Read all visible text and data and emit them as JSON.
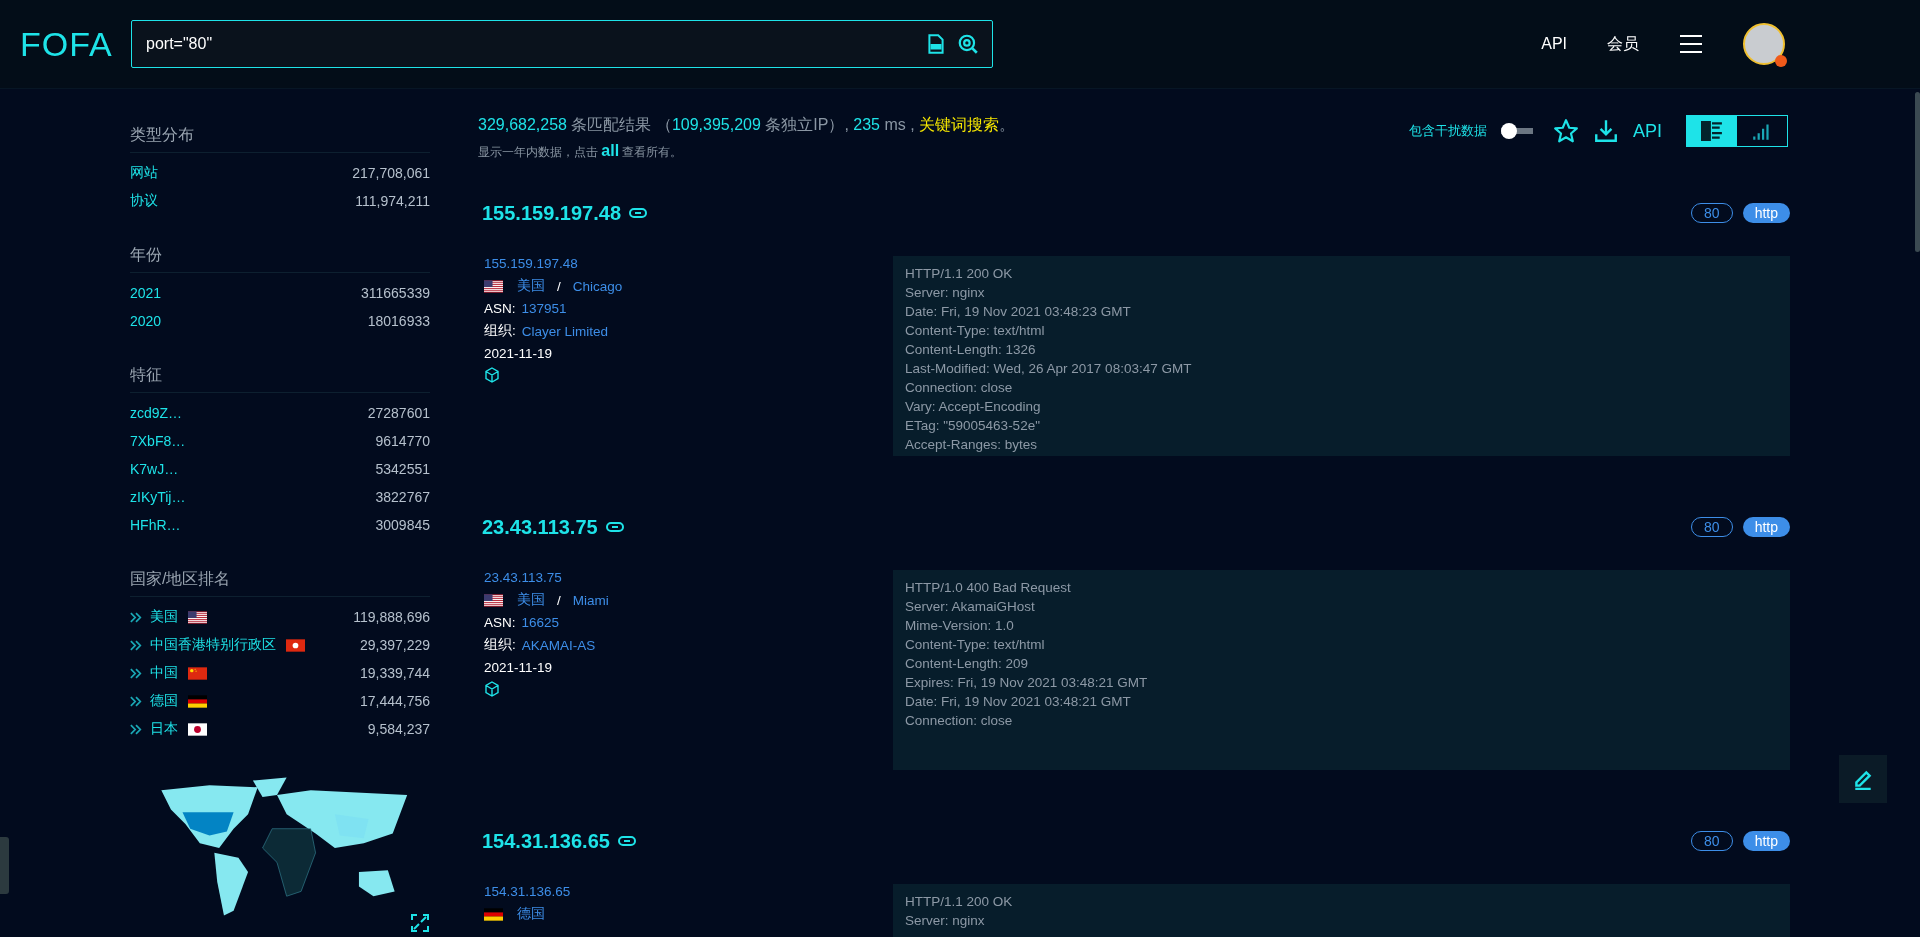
{
  "header": {
    "logo": "FOFA",
    "query": "port=\"80\"",
    "nav": [
      "API",
      "会员"
    ]
  },
  "sidebar": {
    "sections": [
      {
        "title": "类型分布",
        "kind": "plain",
        "rows": [
          {
            "label": "网站",
            "count": "217,708,061"
          },
          {
            "label": "协议",
            "count": "111,974,211"
          }
        ]
      },
      {
        "title": "年份",
        "kind": "plain",
        "rows": [
          {
            "label": "2021",
            "count": "311665339"
          },
          {
            "label": "2020",
            "count": "18016933"
          }
        ]
      },
      {
        "title": "特征",
        "kind": "plain",
        "rows": [
          {
            "label": "zcd9Z…",
            "count": "27287601"
          },
          {
            "label": "7XbF8…",
            "count": "9614770"
          },
          {
            "label": "K7wJ…",
            "count": "5342551"
          },
          {
            "label": "zIKyTij…",
            "count": "3822767"
          },
          {
            "label": "HFhR…",
            "count": "3009845"
          }
        ]
      },
      {
        "title": "国家/地区排名",
        "kind": "country",
        "rows": [
          {
            "label": "美国",
            "kind": "us",
            "count": "119,888,696"
          },
          {
            "label": "中国香港特别行政区",
            "kind": "hk",
            "count": "29,397,229"
          },
          {
            "label": "中国",
            "kind": "cn",
            "count": "19,339,744"
          },
          {
            "label": "德国",
            "kind": "de",
            "count": "17,444,756"
          },
          {
            "label": "日本",
            "kind": "jp",
            "count": "9,584,237"
          }
        ]
      }
    ]
  },
  "summary": {
    "line1": [
      {
        "kind": "number",
        "text": "329,682,258"
      },
      {
        "kind": "text",
        "text": " 条匹配结果 （"
      },
      {
        "kind": "number",
        "text": "109,395,209"
      },
      {
        "kind": "text",
        "text": " 条独立IP）,"
      },
      {
        "kind": "number",
        "text": " 235"
      },
      {
        "kind": "text",
        "text": " ms ,"
      },
      {
        "kind": "highlight",
        "text": " 关键词搜索"
      },
      {
        "kind": "text",
        "text": "。"
      }
    ],
    "line2": [
      {
        "kind": "text",
        "text": "显示一年内数据，点击 "
      },
      {
        "kind": "link",
        "text": "all"
      },
      {
        "kind": "text",
        "text": " 查看所有。"
      }
    ]
  },
  "tools": {
    "toggle_label": "包含干扰数据",
    "toggle_on": false,
    "api": "API",
    "views": [
      {
        "kind": "list",
        "selected": true
      },
      {
        "kind": "chart",
        "selected": false
      }
    ]
  },
  "results": [
    {
      "ip": "155.159.197.48",
      "port": "80",
      "protocol": "http",
      "host": "155.159.197.48",
      "kind": "us",
      "country": "美国",
      "separator": "/",
      "city": "Chicago",
      "asn_label": "ASN:",
      "asn": "137951",
      "org_label": "组织:",
      "org": "Clayer Limited",
      "date": "2021-11-19",
      "banner": [
        "HTTP/1.1 200 OK",
        "Server: nginx",
        "Date: Fri, 19 Nov 2021 03:48:23 GMT",
        "Content-Type: text/html",
        "Content-Length: 1326",
        "Last-Modified: Wed, 26 Apr 2017 08:03:47 GMT",
        "Connection: close",
        "Vary: Accept-Encoding",
        "ETag: \"59005463-52e\"",
        "Accept-Ranges: bytes"
      ]
    },
    {
      "ip": "23.43.113.75",
      "port": "80",
      "protocol": "http",
      "host": "23.43.113.75",
      "kind": "us",
      "country": "美国",
      "separator": "/",
      "city": "Miami",
      "asn_label": "ASN:",
      "asn": "16625",
      "org_label": "组织:",
      "org": "AKAMAI-AS",
      "date": "2021-11-19",
      "banner": [
        "HTTP/1.0 400 Bad Request",
        "Server: AkamaiGHost",
        "Mime-Version: 1.0",
        "Content-Type: text/html",
        "Content-Length: 209",
        "Expires: Fri, 19 Nov 2021 03:48:21 GMT",
        "Date: Fri, 19 Nov 2021 03:48:21 GMT",
        "Connection: close"
      ]
    },
    {
      "ip": "154.31.136.65",
      "port": "80",
      "protocol": "http",
      "host": "154.31.136.65",
      "kind": "de",
      "country": "德国",
      "banner": [
        "HTTP/1.1 200 OK",
        "Server: nginx"
      ]
    }
  ]
}
